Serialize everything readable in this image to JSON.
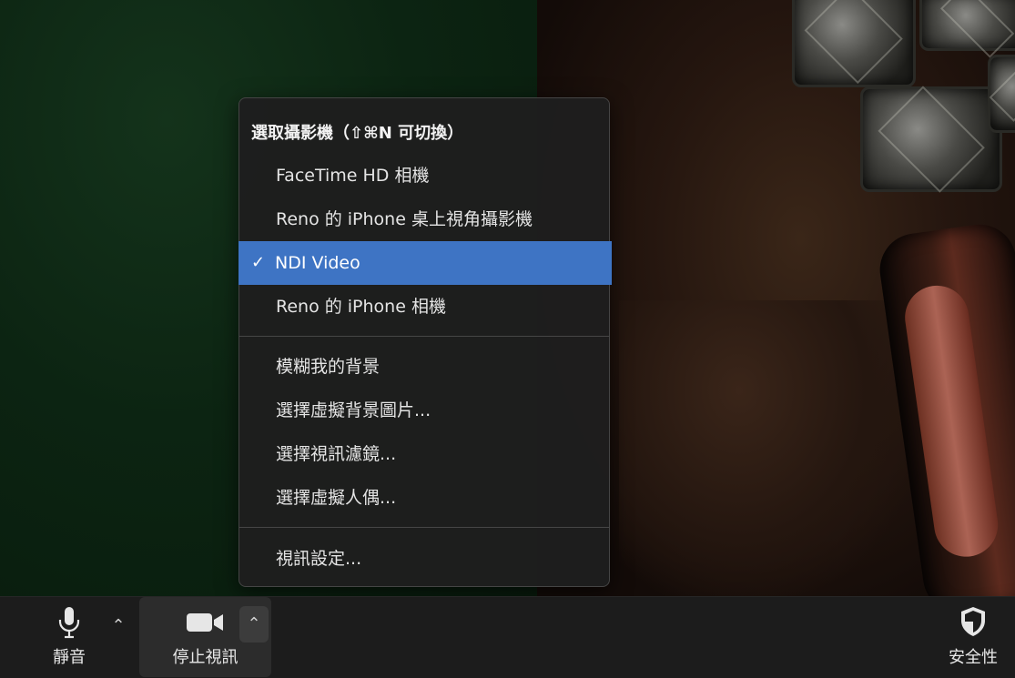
{
  "camera_menu": {
    "header": "選取攝影機（⇧⌘N 可切換）",
    "cameras": [
      {
        "label": "FaceTime HD 相機",
        "selected": false
      },
      {
        "label": "Reno 的 iPhone 桌上視角攝影機",
        "selected": false
      },
      {
        "label": "NDI Video",
        "selected": true
      },
      {
        "label": "Reno 的 iPhone 相機",
        "selected": false
      }
    ],
    "check_mark": "✓",
    "background_options": [
      "模糊我的背景",
      "選擇虛擬背景圖片...",
      "選擇視訊濾鏡...",
      "選擇虛擬人偶..."
    ],
    "settings_label": "視訊設定...",
    "selected_color": "#3e74c4"
  },
  "toolbar": {
    "mute_label": "靜音",
    "stop_video_label": "停止視訊",
    "security_label": "安全性",
    "caret_glyph": "⌃",
    "mic_icon": "microphone-icon",
    "video_icon": "video-camera-icon",
    "security_icon": "shield-icon"
  }
}
